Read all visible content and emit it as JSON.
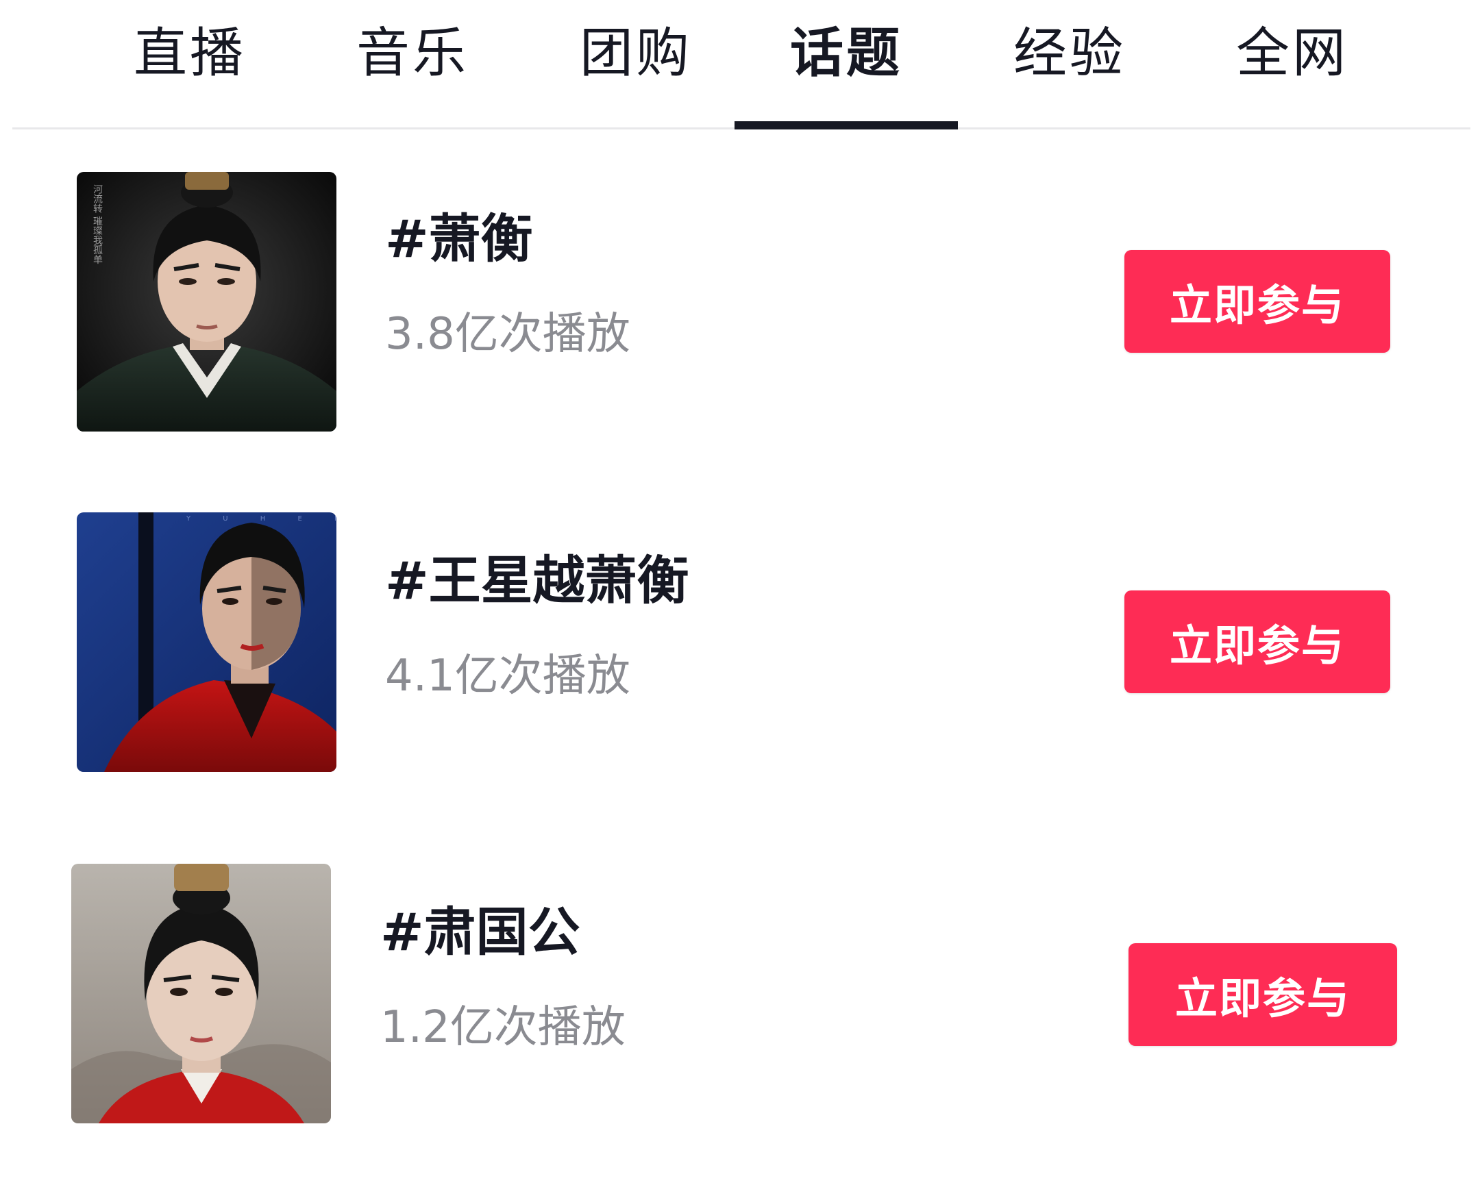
{
  "tabs": [
    {
      "label": "直播"
    },
    {
      "label": "音乐"
    },
    {
      "label": "团购"
    },
    {
      "label": "话题",
      "active": true
    },
    {
      "label": "经验"
    },
    {
      "label": "全网"
    }
  ],
  "topics": [
    {
      "title": "#萧衡",
      "views": "3.8亿次播放",
      "button": "立即参与",
      "poster_text": "河流转 璀璨我孤单"
    },
    {
      "title": "#王星越萧衡",
      "views": "4.1亿次播放",
      "button": "立即参与",
      "poster_text": "Y U H E N"
    },
    {
      "title": "#肃国公",
      "views": "1.2亿次播放",
      "button": "立即参与"
    }
  ],
  "colors": {
    "accent": "#fe2c55",
    "text_primary": "#161823",
    "text_secondary": "#8a8b91",
    "divider": "#e8e8ea"
  }
}
